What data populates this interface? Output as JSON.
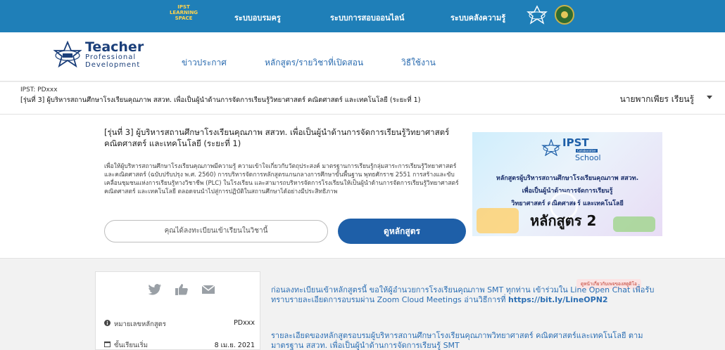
{
  "topbar": {
    "brand_line1": "IPST",
    "brand_line2": "LEARNING",
    "brand_line3": "SPACE",
    "nav": [
      "ระบบอบรมครู",
      "ระบบการสอบออนไลน์",
      "ระบบคลังความรู้"
    ]
  },
  "header": {
    "logo_title": "Teacher",
    "logo_line2": "Professional",
    "logo_line3": "Development",
    "menu": [
      "ข่าวประกาศ",
      "หลักสูตร/รายวิชาที่เปิดสอน",
      "วิธีใช้งาน"
    ]
  },
  "course_strip": {
    "code": "IPST: PDxxx",
    "title": "[รุ่นที่ 3] ผู้บริหารสถานศึกษาโรงเรียนคุณภาพ สสวท. เพื่อเป็นผู้นำด้านการจัดการเรียนรู้วิทยาศาสตร์ คณิตศาสตร์ และเทคโนโลยี (ระยะที่ 1)",
    "user_name": "นายพากเพียร เรียนรู้"
  },
  "card": {
    "title": "[รุ่นที่ 3] ผู้บริหารสถานศึกษาโรงเรียนคุณภาพ สสวท. เพื่อเป็นผู้นำด้านการจัดการเรียนรู้วิทยาศาสตร์ คณิตศาสตร์ และเทคโนโลยี (ระยะที่ 1)",
    "description": "เพื่อให้ผู้บริหารสถานศึกษาโรงเรียนคุณภาพมีความรู้ ความเข้าใจเกี่ยวกับวัตถุประสงค์ มาตรฐานการเรียนรู้กลุ่มสาระการเรียนรู้วิทยาศาสตร์และคณิตศาสตร์ (ฉบับปรับปรุง พ.ศ. 2560) การบริหารจัดการหลักสูตรแกนกลางการศึกษาขั้นพื้นฐาน พุทธศักราช 2551 การสร้างและขับเคลื่อนชุมชนแห่งการเรียนรู้ทางวิชาชีพ (PLC) ในโรงเรียน และสามารถบริหารจัดการโรงเรียนให้เป็นผู้นำด้านการจัดการเรียนรู้วิทยาศาสตร์ คณิตศาสตร์ และเทคโนโลยี ตลอดจนนำไปสู่การปฏิบัติในสถานศึกษาได้อย่างมีประสิทธิภาพ",
    "enroll_text": "คุณได้ลงทะเบียนเข้าเรียนในวิชานี้",
    "view_button": "ดูหลักสูตร"
  },
  "thumbnail": {
    "ipst": "IPST",
    "collab": "Collaborative",
    "school": "School",
    "line1": "หลักสูตรผู้บริหารสถานศึกษาโรงเรียนคุณภาพ สสวท.",
    "line2": "เพื่อเป็นผู้นำด้านการจัดการเรียนรู้",
    "line3": "วิทยาศาสตร์ คณิตศาสตร์ และเทคโนโลยี",
    "big": "หลักสูตร 2"
  },
  "side_panel": {
    "course_code_label": "หมายเลขหลักสูตร",
    "course_code_value": "PDxxx",
    "start_label": "ขั้นเรียนเริ่ม",
    "start_value": "8 เม.ย. 2021"
  },
  "main_notes": {
    "notice_link": "ดูหน้าเกี่ยวกับเพจของสตูดิโอ",
    "announce_text": "ก่อนลงทะเบียนเข้าหลักสูตรนี้ ขอให้ผู้อำนวยการโรงเรียนคุณภาพ SMT ทุกท่าน เข้าร่วมใน Line Open Chat เพื่อรับทราบรายละเอียดการอบรมผ่าน Zoom Cloud Meetings อ่านวิธีการที่",
    "announce_url": "https://bit.ly/LineOPN2",
    "detail_text": "รายละเอียดของหลักสูตรอบรมผู้บริหารสถานศึกษาโรงเรียนคุณภาพวิทยาศาสตร์ คณิตศาสตร์และเทคโนโลยี ตามมาตรฐาน สสวท. เพื่อเป็นผู้นำด้านการจัดการเรียนรู้ SMT"
  },
  "colors": {
    "topbar": "#1f7fb8",
    "primary_button": "#1e5fa8",
    "link": "#2c6fb4"
  }
}
